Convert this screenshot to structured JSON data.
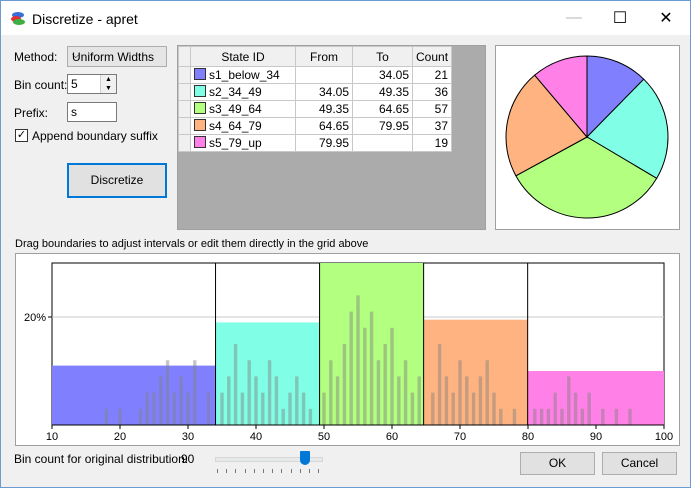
{
  "window": {
    "title": "Discretize - apret",
    "minimize_glyph": "—",
    "maximize_glyph": "☐",
    "close_glyph": "✕"
  },
  "controls": {
    "method_label": "Method:",
    "method_value": "Uniform Widths",
    "bin_count_label": "Bin count:",
    "bin_count_value": "5",
    "prefix_label": "Prefix:",
    "prefix_value": "s",
    "append_label": "Append boundary suffix",
    "append_checked": true,
    "discretize_button": "Discretize"
  },
  "grid": {
    "columns": [
      "State ID",
      "From",
      "To",
      "Count"
    ],
    "rows": [
      {
        "color": "#8080ff",
        "id": "s1_below_34",
        "from": "",
        "to": "34.05",
        "count": "21"
      },
      {
        "color": "#80ffe6",
        "id": "s2_34_49",
        "from": "34.05",
        "to": "49.35",
        "count": "36"
      },
      {
        "color": "#b3ff80",
        "id": "s3_49_64",
        "from": "49.35",
        "to": "64.65",
        "count": "57"
      },
      {
        "color": "#ffb380",
        "id": "s4_64_79",
        "from": "64.65",
        "to": "79.95",
        "count": "37"
      },
      {
        "color": "#ff80e6",
        "id": "s5_79_up",
        "from": "79.95",
        "to": "",
        "count": "19"
      }
    ]
  },
  "hint_text": "Drag boundaries to adjust intervals or edit them directly in the grid above",
  "chart_data": [
    {
      "type": "pie",
      "labels": [
        "s1_below_34",
        "s2_34_49",
        "s3_49_64",
        "s4_64_79",
        "s5_79_up"
      ],
      "values": [
        21,
        36,
        57,
        37,
        19
      ],
      "colors": [
        "#8080ff",
        "#80ffe6",
        "#b3ff80",
        "#ffb380",
        "#ff80e6"
      ]
    },
    {
      "type": "bar",
      "xlim": [
        10,
        100
      ],
      "xticks": [
        10,
        20,
        30,
        40,
        50,
        60,
        70,
        80,
        90,
        100
      ],
      "ylim": [
        0,
        0.3
      ],
      "yticks": [
        {
          "value": 0.2,
          "label": "20%"
        }
      ],
      "bins": [
        {
          "from": 10,
          "to": 34.05,
          "height": 0.11,
          "color": "#8080ff"
        },
        {
          "from": 34.05,
          "to": 49.35,
          "height": 0.19,
          "color": "#80ffe6"
        },
        {
          "from": 49.35,
          "to": 64.65,
          "height": 0.3,
          "color": "#b3ff80"
        },
        {
          "from": 64.65,
          "to": 79.95,
          "height": 0.195,
          "color": "#ffb380"
        },
        {
          "from": 79.95,
          "to": 100,
          "height": 0.1,
          "color": "#ff80e6"
        }
      ],
      "boundaries": [
        34.05,
        49.35,
        64.65,
        79.95
      ],
      "fine_bars": [
        [
          18,
          0.03
        ],
        [
          20,
          0.03
        ],
        [
          23,
          0.03
        ],
        [
          24,
          0.06
        ],
        [
          25,
          0.06
        ],
        [
          26,
          0.09
        ],
        [
          27,
          0.12
        ],
        [
          28,
          0.06
        ],
        [
          29,
          0.09
        ],
        [
          30,
          0.06
        ],
        [
          31,
          0.12
        ],
        [
          33,
          0.06
        ],
        [
          35,
          0.06
        ],
        [
          36,
          0.09
        ],
        [
          37,
          0.15
        ],
        [
          38,
          0.06
        ],
        [
          39,
          0.12
        ],
        [
          40,
          0.09
        ],
        [
          41,
          0.06
        ],
        [
          42,
          0.12
        ],
        [
          43,
          0.09
        ],
        [
          44,
          0.03
        ],
        [
          45,
          0.06
        ],
        [
          46,
          0.09
        ],
        [
          47,
          0.06
        ],
        [
          48,
          0.03
        ],
        [
          50,
          0.06
        ],
        [
          51,
          0.12
        ],
        [
          52,
          0.09
        ],
        [
          53,
          0.15
        ],
        [
          54,
          0.21
        ],
        [
          55,
          0.24
        ],
        [
          56,
          0.18
        ],
        [
          57,
          0.21
        ],
        [
          58,
          0.12
        ],
        [
          59,
          0.15
        ],
        [
          60,
          0.18
        ],
        [
          61,
          0.09
        ],
        [
          62,
          0.12
        ],
        [
          63,
          0.06
        ],
        [
          64,
          0.09
        ],
        [
          66,
          0.06
        ],
        [
          67,
          0.15
        ],
        [
          68,
          0.09
        ],
        [
          69,
          0.06
        ],
        [
          70,
          0.12
        ],
        [
          71,
          0.09
        ],
        [
          72,
          0.06
        ],
        [
          73,
          0.09
        ],
        [
          74,
          0.12
        ],
        [
          75,
          0.06
        ],
        [
          76,
          0.03
        ],
        [
          78,
          0.03
        ],
        [
          81,
          0.03
        ],
        [
          82,
          0.03
        ],
        [
          83,
          0.03
        ],
        [
          84,
          0.06
        ],
        [
          85,
          0.03
        ],
        [
          86,
          0.09
        ],
        [
          87,
          0.06
        ],
        [
          88,
          0.03
        ],
        [
          89,
          0.06
        ],
        [
          91,
          0.03
        ],
        [
          93,
          0.03
        ],
        [
          95,
          0.03
        ]
      ]
    }
  ],
  "bottom": {
    "slider_label": "Bin count for original distribution:",
    "slider_value": "90",
    "slider_fraction": 0.85,
    "ok_button": "OK",
    "cancel_button": "Cancel"
  }
}
